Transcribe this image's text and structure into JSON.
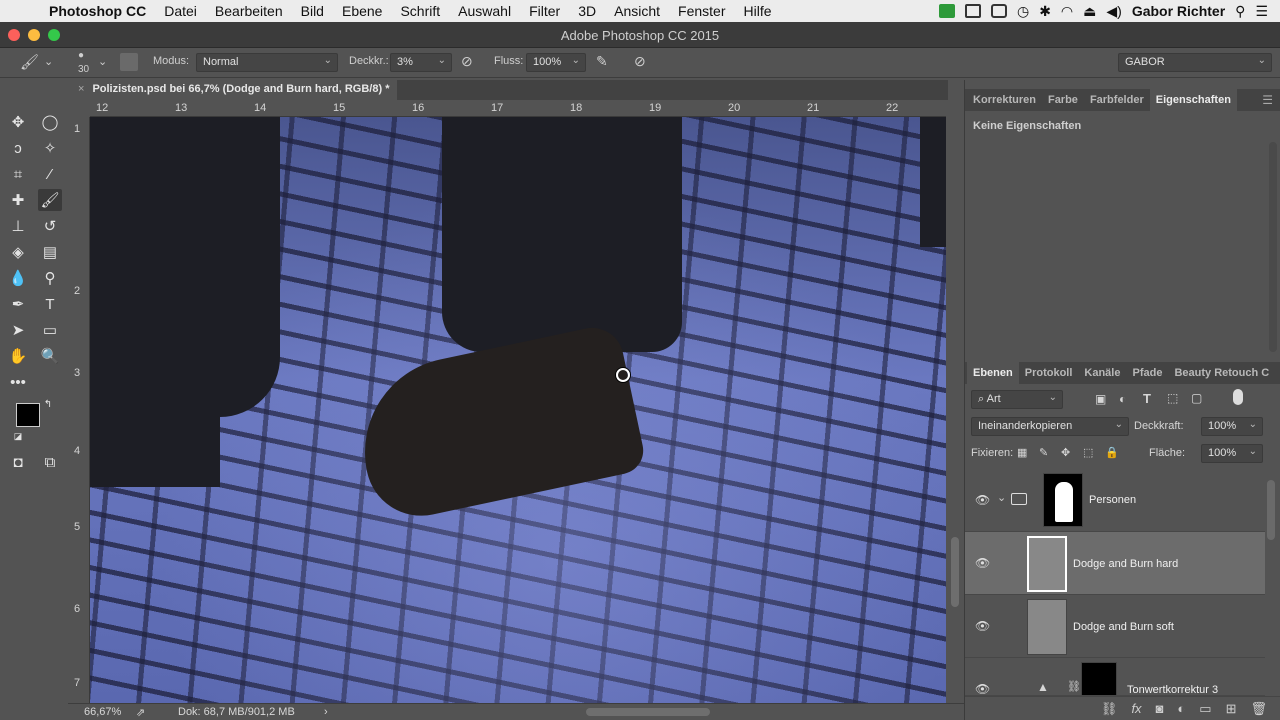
{
  "menubar": {
    "app": "Photoshop CC",
    "items": [
      "Datei",
      "Bearbeiten",
      "Bild",
      "Ebene",
      "Schrift",
      "Auswahl",
      "Filter",
      "3D",
      "Ansicht",
      "Fenster",
      "Hilfe"
    ],
    "user": "Gabor Richter"
  },
  "window": {
    "title": "Adobe Photoshop CC 2015"
  },
  "options": {
    "brush_size": "30",
    "mode_label": "Modus:",
    "mode_value": "Normal",
    "opacity_label": "Deckkr.:",
    "opacity_value": "3%",
    "flow_label": "Fluss:",
    "flow_value": "100%",
    "workspace": "GABOR"
  },
  "document": {
    "tab_title": "Polizisten.psd bei 66,7% (Dodge and Burn hard, RGB/8) *",
    "ruler_h": [
      "12",
      "13",
      "14",
      "15",
      "16",
      "17",
      "18",
      "19",
      "20",
      "21",
      "22"
    ],
    "ruler_v": [
      "1",
      "2",
      "3",
      "4",
      "5",
      "6",
      "7"
    ]
  },
  "status": {
    "zoom": "66,67%",
    "doc_info": "Dok: 68,7 MB/901,2 MB"
  },
  "props_panel": {
    "tabs": [
      "Korrekturen",
      "Farbe",
      "Farbfelder",
      "Eigenschaften"
    ],
    "active_tab": "Eigenschaften",
    "content": "Keine Eigenschaften"
  },
  "layers_panel": {
    "tabs": [
      "Ebenen",
      "Protokoll",
      "Kanäle",
      "Pfade",
      "Beauty Retouch C"
    ],
    "active_tab": "Ebenen",
    "filter": "Art",
    "blend_mode": "Ineinanderkopieren",
    "opacity_label": "Deckkraft:",
    "opacity_value": "100%",
    "lock_label": "Fixieren:",
    "fill_label": "Fläche:",
    "fill_value": "100%",
    "layers": [
      {
        "name": "Personen",
        "type": "group",
        "selected": false
      },
      {
        "name": "Dodge and Burn hard",
        "type": "pixel",
        "selected": true
      },
      {
        "name": "Dodge and Burn soft",
        "type": "pixel",
        "selected": false
      },
      {
        "name": "Tonwertkorrektur 3",
        "type": "adjustment",
        "selected": false
      }
    ]
  },
  "colors": {
    "accent_close": "#fc605b",
    "accent_min": "#fdbc40",
    "accent_max": "#34c84a"
  }
}
